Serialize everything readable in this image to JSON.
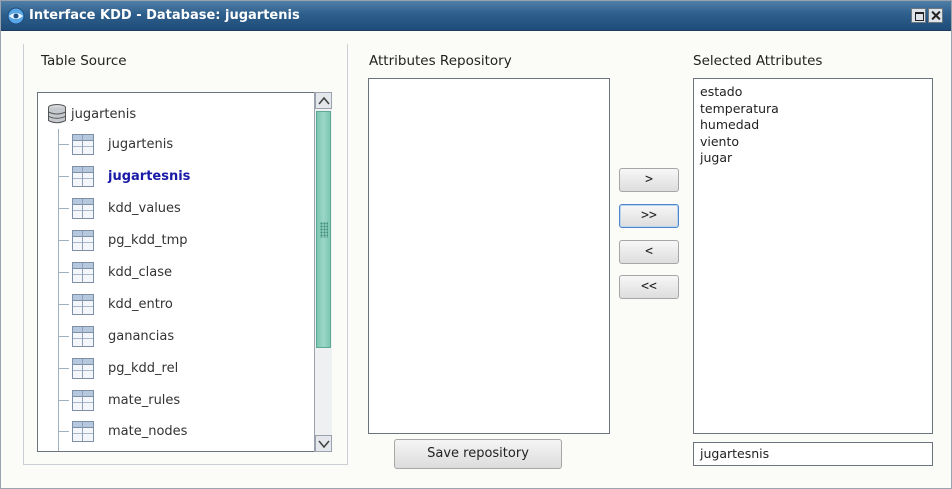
{
  "window": {
    "title": "Interface KDD - Database: jugartenis",
    "icon": "app-icon"
  },
  "table_source": {
    "label": "Table Source",
    "root": "jugartenis",
    "tables": [
      {
        "name": "jugartenis",
        "selected": false
      },
      {
        "name": "jugartesnis",
        "selected": true
      },
      {
        "name": "kdd_values",
        "selected": false
      },
      {
        "name": "pg_kdd_tmp",
        "selected": false
      },
      {
        "name": "kdd_clase",
        "selected": false
      },
      {
        "name": "kdd_entro",
        "selected": false
      },
      {
        "name": "ganancias",
        "selected": false
      },
      {
        "name": "pg_kdd_rel",
        "selected": false
      },
      {
        "name": "mate_rules",
        "selected": false
      },
      {
        "name": "mate_nodes",
        "selected": false
      }
    ]
  },
  "attributes_repository": {
    "label": "Attributes Repository",
    "items": [],
    "save_button": "Save repository"
  },
  "transfer_buttons": {
    "add": ">",
    "add_all": ">>",
    "remove": "<",
    "remove_all": "<<"
  },
  "selected_attributes": {
    "label": "Selected Attributes",
    "items": [
      "estado",
      "temperatura",
      "humedad",
      "viento",
      "jugar"
    ],
    "table_name_value": "jugartesnis"
  },
  "colors": {
    "titlebar": "#2e5f8c",
    "scroll_thumb": "#7cc6b2",
    "selected_item": "#1a1aa8",
    "focus_border": "#4e86c8"
  }
}
